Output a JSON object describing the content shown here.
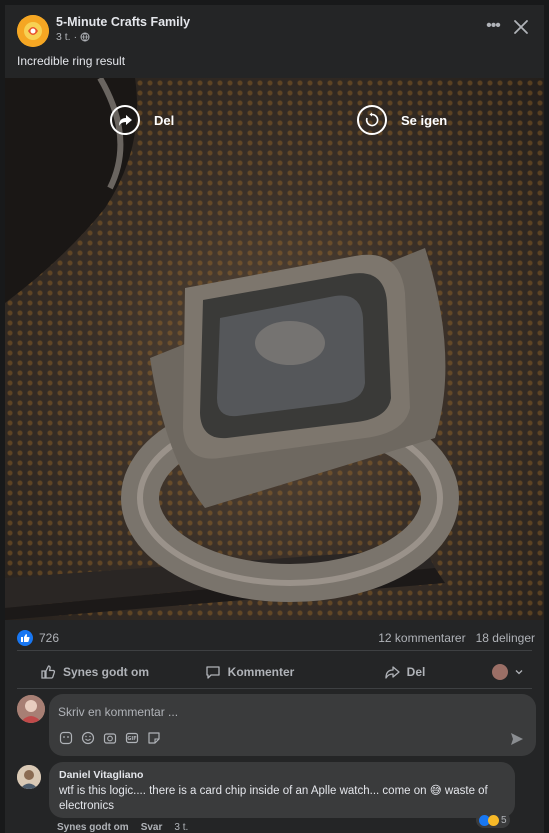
{
  "post": {
    "page_name": "5-Minute Crafts Family",
    "time": "3 t.",
    "caption": "Incredible ring result"
  },
  "video": {
    "share_label": "Del",
    "replay_label": "Se igen"
  },
  "counts": {
    "reactions": "726",
    "comments": "12 kommentarer",
    "shares": "18 delinger"
  },
  "actions": {
    "like": "Synes godt om",
    "comment": "Kommenter",
    "share": "Del"
  },
  "composer": {
    "placeholder": "Skriv en kommentar ..."
  },
  "comment": {
    "author": "Daniel Vitagliano",
    "text": "wtf is this logic.... there is a card chip inside of an Aplle watch... come on 😅 waste of electronics",
    "reaction_count": "5",
    "like": "Synes godt om",
    "reply": "Svar",
    "time": "3 t."
  },
  "colors": {
    "card_bg": "#242526",
    "accent_blue": "#1877f2",
    "text_secondary": "#b0b3b8"
  }
}
